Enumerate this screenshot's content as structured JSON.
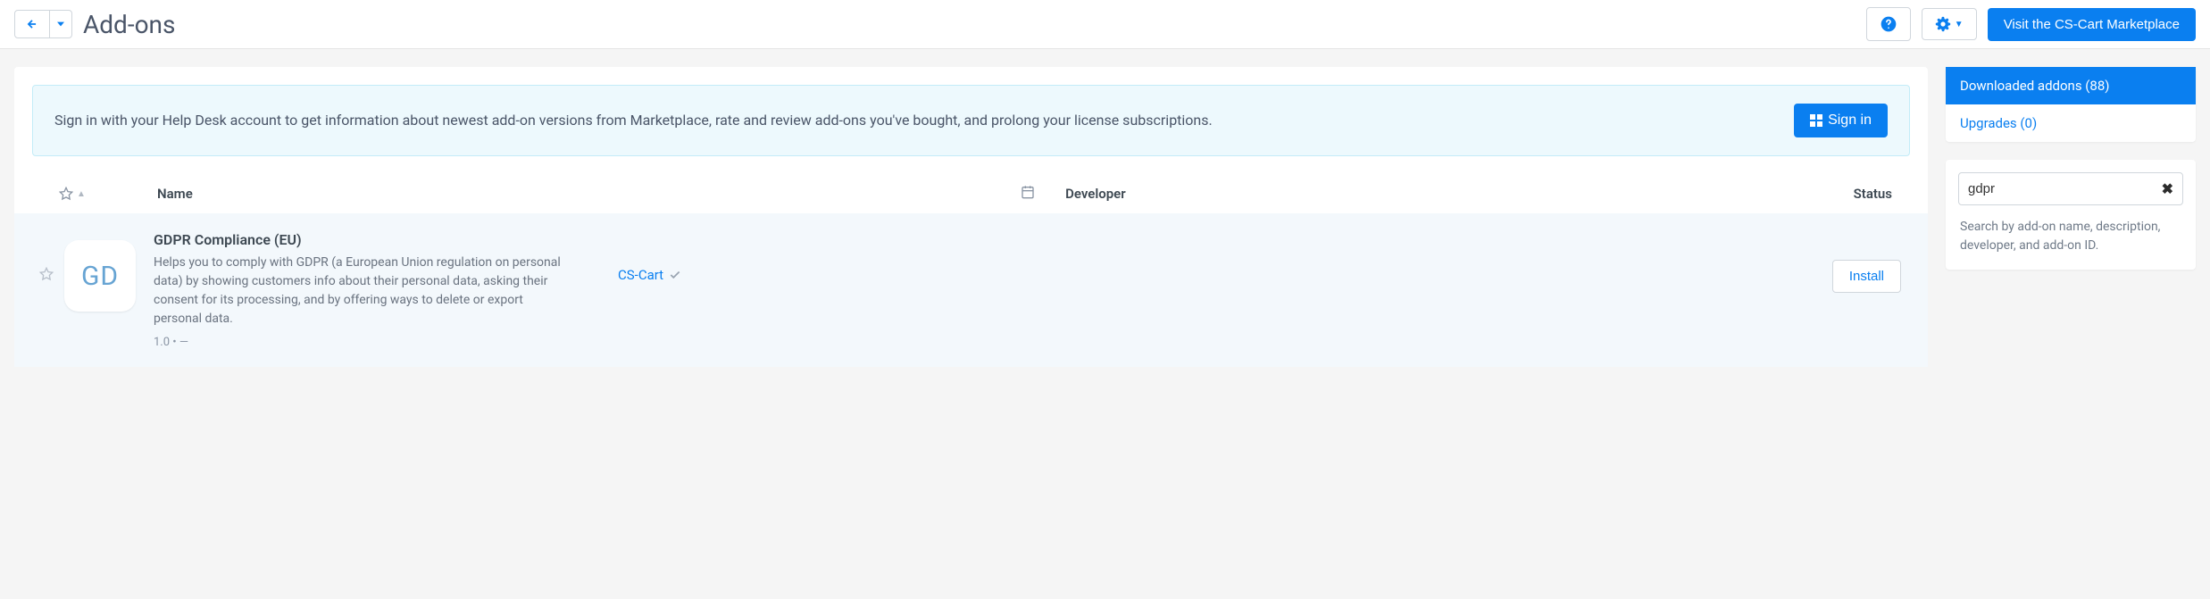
{
  "header": {
    "title": "Add-ons",
    "marketplace_btn": "Visit the CS-Cart Marketplace"
  },
  "alert": {
    "text": "Sign in with your Help Desk account to get information about newest add-on versions from Marketplace, rate and review add-ons you've bought, and prolong your license subscriptions.",
    "signin_label": "Sign in"
  },
  "table": {
    "columns": {
      "name": "Name",
      "developer": "Developer",
      "status": "Status"
    }
  },
  "addons": [
    {
      "badge": "GD",
      "name": "GDPR Compliance (EU)",
      "description": "Helps you to comply with GDPR (a European Union regulation on personal data) by showing customers info about their personal data, asking their consent for its processing, and by offering ways to delete or export personal data.",
      "version": "1.0 • —",
      "developer": "CS-Cart",
      "action": "Install"
    }
  ],
  "sidebar": {
    "tabs": {
      "downloaded": "Downloaded addons (88)",
      "upgrades": "Upgrades (0)"
    },
    "search": {
      "value": "gdpr",
      "hint": "Search by add-on name, description, developer, and add-on ID."
    }
  }
}
